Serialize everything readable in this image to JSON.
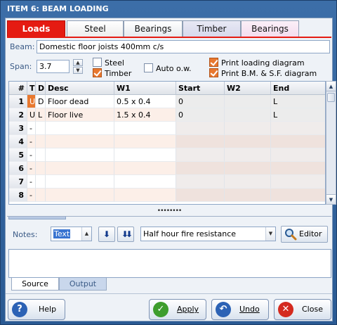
{
  "window": {
    "title": "ITEM 6: BEAM LOADING"
  },
  "tabs": [
    {
      "label": "Loads"
    },
    {
      "label": "Steel"
    },
    {
      "label": "Bearings"
    },
    {
      "label": "Timber"
    },
    {
      "label": "Bearings"
    }
  ],
  "form": {
    "beam_label": "Beam:",
    "beam_value": "Domestic floor joists 400mm c/s",
    "span_label": "Span:",
    "span_value": "3.7",
    "checks": {
      "steel": {
        "label": "Steel",
        "checked": false
      },
      "timber": {
        "label": "Timber",
        "checked": true
      },
      "auto_ow": {
        "label": "Auto o.w.",
        "checked": false
      },
      "print_loading": {
        "label": "Print loading diagram",
        "checked": true
      },
      "print_bm": {
        "label": "Print B.M. & S.F. diagram",
        "checked": true
      }
    }
  },
  "grid": {
    "headers": [
      "#",
      "T",
      "D",
      "Desc",
      "W1",
      "Start",
      "W2",
      "End"
    ],
    "rows": [
      {
        "n": "1",
        "t": "U",
        "d": "D",
        "desc": "Floor dead",
        "w1": "0.5 x 0.4",
        "start": "0",
        "w2": "",
        "end": "L"
      },
      {
        "n": "2",
        "t": "U",
        "d": "L",
        "desc": "Floor live",
        "w1": "1.5 x 0.4",
        "start": "0",
        "w2": "",
        "end": "L"
      },
      {
        "n": "3",
        "t": "-",
        "d": "",
        "desc": "",
        "w1": "",
        "start": "",
        "w2": "",
        "end": ""
      },
      {
        "n": "4",
        "t": "-",
        "d": "",
        "desc": "",
        "w1": "",
        "start": "",
        "w2": "",
        "end": ""
      },
      {
        "n": "5",
        "t": "-",
        "d": "",
        "desc": "",
        "w1": "",
        "start": "",
        "w2": "",
        "end": ""
      },
      {
        "n": "6",
        "t": "-",
        "d": "",
        "desc": "",
        "w1": "",
        "start": "",
        "w2": "",
        "end": ""
      },
      {
        "n": "7",
        "t": "-",
        "d": "",
        "desc": "",
        "w1": "",
        "start": "",
        "w2": "",
        "end": ""
      },
      {
        "n": "8",
        "t": "-",
        "d": "",
        "desc": "",
        "w1": "",
        "start": "",
        "w2": "",
        "end": ""
      }
    ]
  },
  "notes": {
    "label": "Notes:",
    "type_value": "Text",
    "template_value": "Half hour fire resistance",
    "editor_label": "Editor",
    "tabs": [
      "Source",
      "Output"
    ]
  },
  "buttons": {
    "help": "Help",
    "apply": "Apply",
    "undo": "Undo",
    "close": "Close"
  },
  "colors": {
    "accent_red": "#e51b12",
    "check_orange": "#e8782f",
    "title_blue": "#2f609a"
  }
}
